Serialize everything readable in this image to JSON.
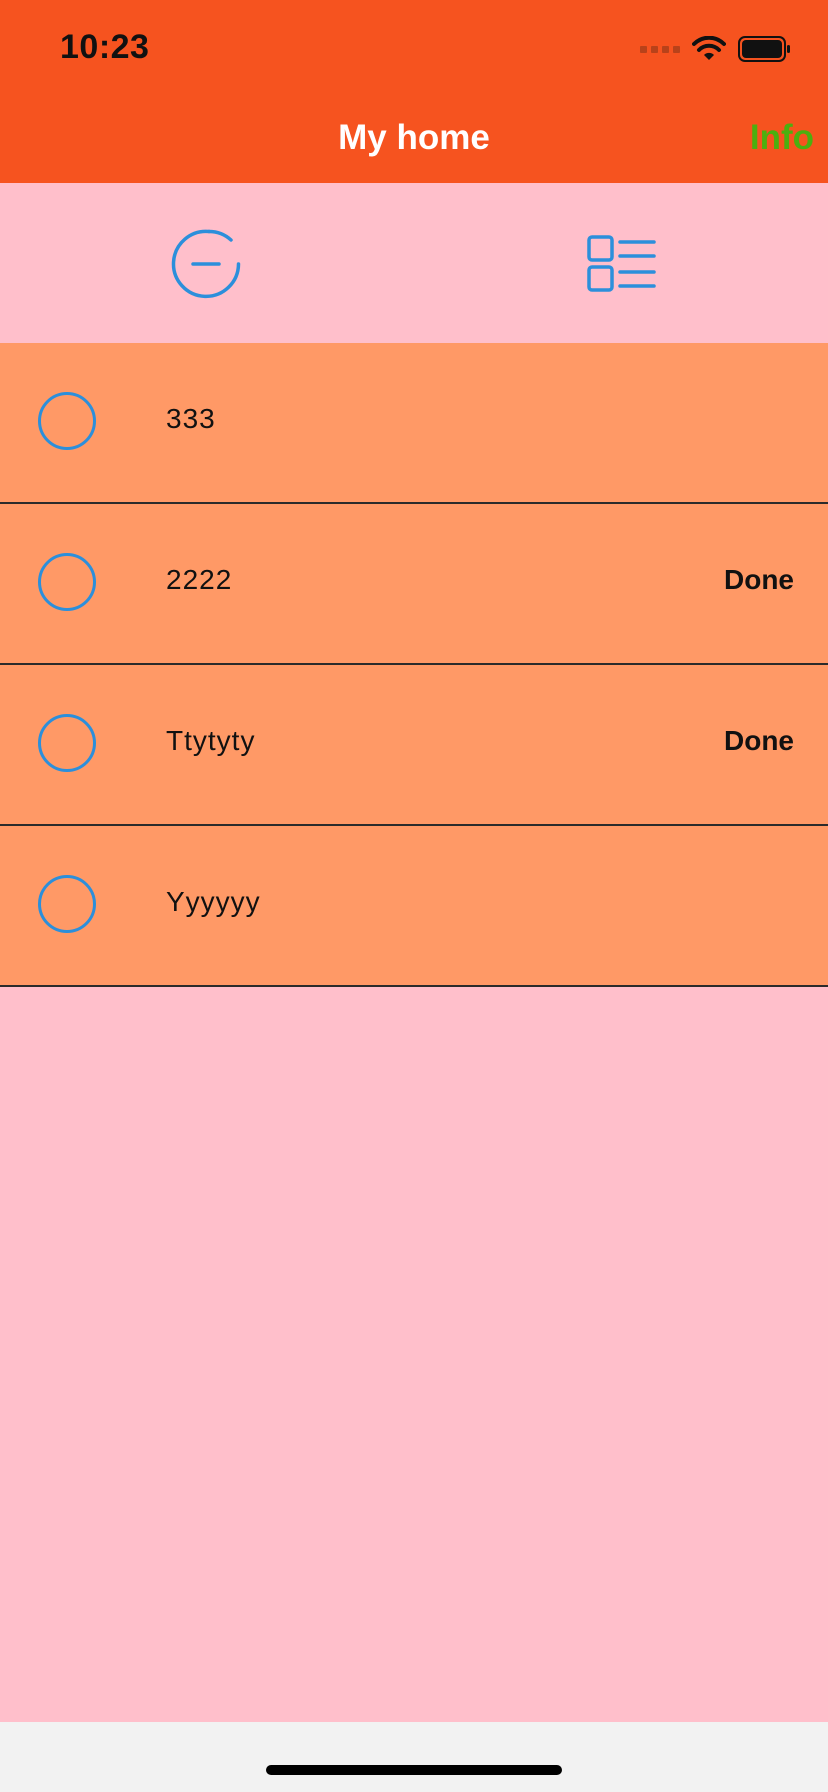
{
  "status_bar": {
    "time": "10:23",
    "icons": [
      "cellular-signal-icon",
      "wifi-icon",
      "battery-icon"
    ]
  },
  "nav": {
    "title": "My home",
    "right_button": "Info"
  },
  "toolbar": {
    "buttons": [
      {
        "icon": "minus-circle-icon"
      },
      {
        "icon": "checklist-icon"
      }
    ]
  },
  "items": [
    {
      "title": "333",
      "status": ""
    },
    {
      "title": "2222",
      "status": "Done"
    },
    {
      "title": "Ttytyty",
      "status": "Done"
    },
    {
      "title": "Yyyyyy",
      "status": ""
    }
  ],
  "colors": {
    "header": "#F6531F",
    "background": "#FFBFCB",
    "row": "#FF9966",
    "accent_blue": "#2C8FDB",
    "info_green": "#4CAF0F"
  }
}
